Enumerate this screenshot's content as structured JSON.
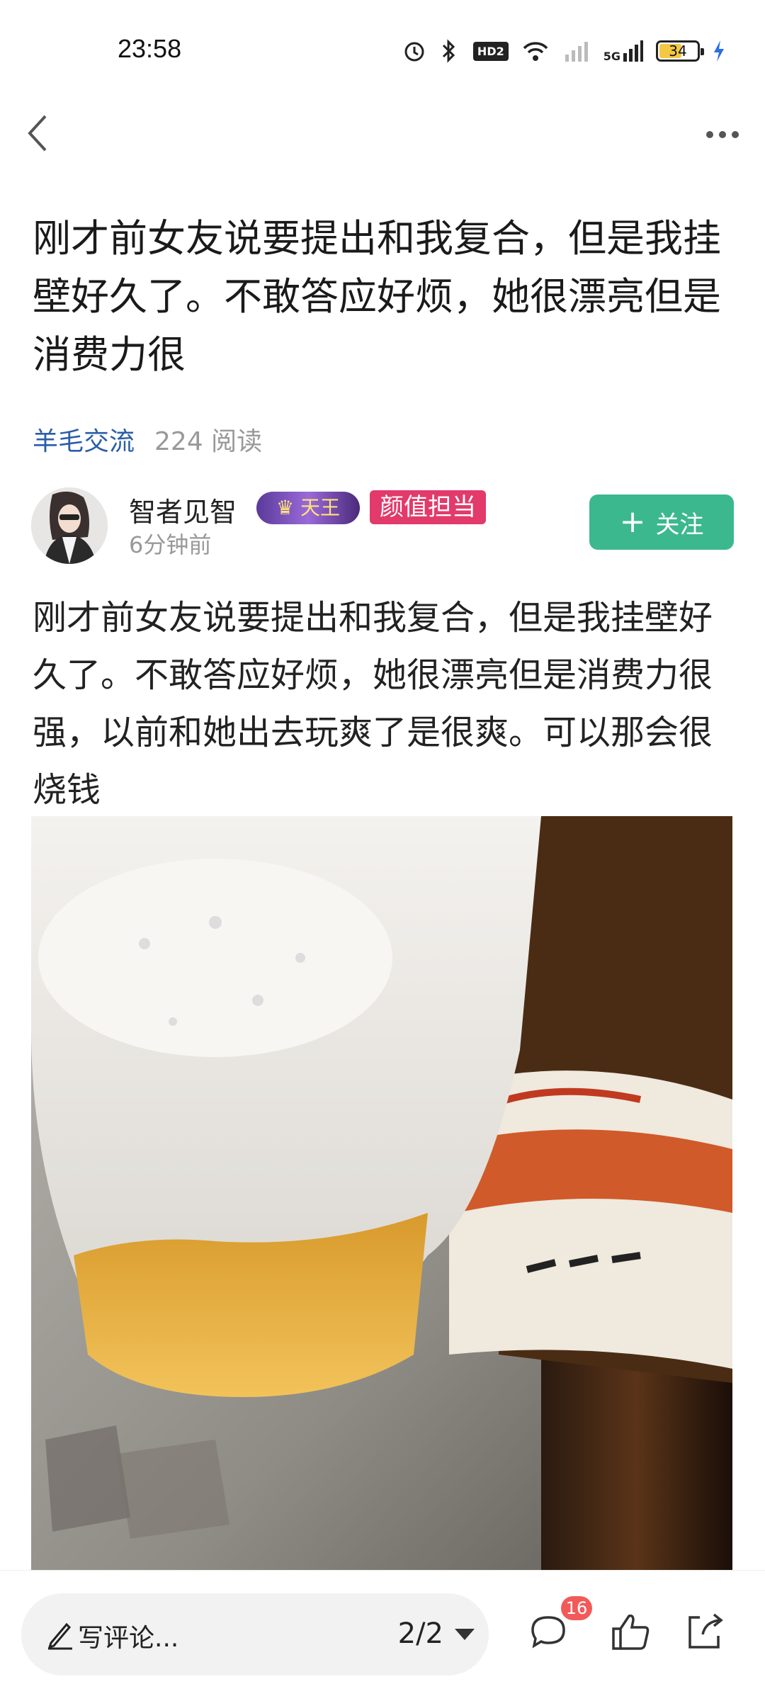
{
  "status": {
    "time": "23:58",
    "battery": "34",
    "network": "5G",
    "hd": "HD2"
  },
  "post": {
    "title": "刚才前女友说要提出和我复合，但是我挂壁好久了。不敢答应好烦，她很漂亮但是消费力很",
    "forum": "羊毛交流",
    "reads": "224 阅读",
    "author": "智者见智",
    "badge_title": "天王",
    "badge_tag": "颜值担当",
    "time_ago": "6分钟前",
    "follow_label": "关注",
    "body": "刚才前女友说要提出和我复合，但是我挂壁好久了。不敢答应好烦，她很漂亮但是消费力很强，以前和她出去玩爽了是很爽。可以那会很烧钱"
  },
  "bottom": {
    "comment_placeholder": "写评论...",
    "pager": "2/2",
    "comment_count": "16"
  },
  "colors": {
    "accent": "#3cb88e",
    "forum": "#2a5ea8",
    "tag": "#e23a6a",
    "badge": "#f25a5a"
  },
  "icons": [
    "back-icon",
    "more-icon",
    "pen-icon",
    "comment-icon",
    "like-icon",
    "share-icon"
  ]
}
